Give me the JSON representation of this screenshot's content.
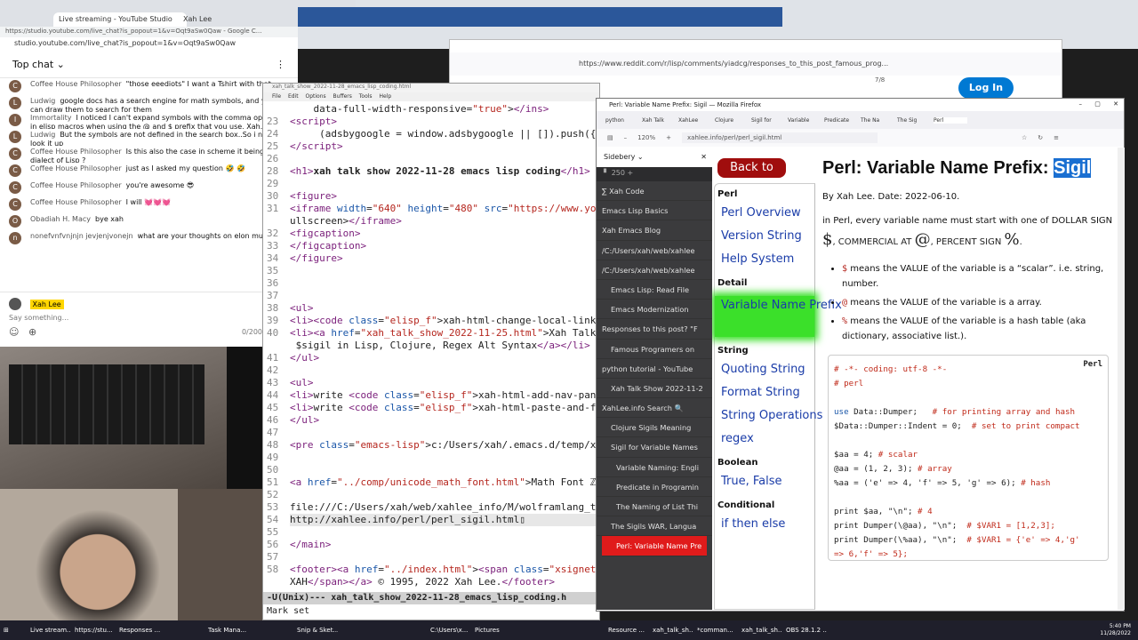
{
  "chrome_top": {
    "tab1": "Live streaming - YouTube Studio",
    "tab2": "Xah Lee",
    "url_full": "https://studio.youtube.com/live_chat?is_popout=1&v=Oqt9aSw0Qaw - Google C...",
    "url": "studio.youtube.com/live_chat?is_popout=1&v=Oqt9aSw0Qaw"
  },
  "chat": {
    "title": "Top chat",
    "messages": [
      {
        "author": "Coffee House Philosopher",
        "text": "\"those eeediots\" I want a Tshirt with that"
      },
      {
        "author": "Ludwig",
        "text": "google docs has a search engine for math symbols, and you can draw them to search for them"
      },
      {
        "author": "Immortality",
        "text": "I noticed I can't expand symbols with the comma operator in elisp macros when using the @ and $ prefix that you use, Xah. I'm not sure why."
      },
      {
        "author": "Ludwig",
        "text": "But the symbols are not defined in the search box..So i need look it up"
      },
      {
        "author": "Coffee House Philosopher",
        "text": "Is this also the case in scheme it being a dialect of Lisp ?"
      },
      {
        "author": "Coffee House Philosopher",
        "text": "just as I asked my question 🤣 🤣"
      },
      {
        "author": "Coffee House Philosopher",
        "text": "you're awesome 😎"
      },
      {
        "author": "Coffee House Philosopher",
        "text": "I will 💓💓💓"
      },
      {
        "author": "Obadiah H. Macy",
        "text": "bye xah"
      },
      {
        "author": "nonefvnfvnjnjn jevjenjvonejn",
        "text": "what are your thoughts on elon musk?"
      }
    ],
    "user": "Xah Lee",
    "placeholder": "Say something...",
    "count": "0/200"
  },
  "emacs": {
    "title": "xah_talk_show_2022-11-28_emacs_lisp_coding.html",
    "menu": "File Edit Options Buffers Tools Help",
    "modeline": "-U(Unix)---  xah_talk_show_2022-11-28_emacs_lisp_coding.h",
    "minibuffer": "Mark set"
  },
  "reddit": {
    "url": "https://www.reddit.com/r/lisp/comments/yiadcg/responses_to_this_post_famous_prog...",
    "login": "Log In",
    "page": "7/8"
  },
  "firefox": {
    "title": "Perl: Variable Name Prefix: Sigil — Mozilla Firefox",
    "zoom": "120%",
    "url": "xahlee.info/perl/perl_sigil.html",
    "tabs": [
      "python",
      "Xah Talk",
      "XahLee",
      "Clojure",
      "Sigil for",
      "Variable",
      "Predicate",
      "The Na",
      "The Sig",
      "Perl"
    ]
  },
  "sidebery": {
    "title": "Sidebery",
    "count": "250",
    "items": [
      {
        "label": "∑ Xah Code",
        "level": 0
      },
      {
        "label": "Emacs Lisp Basics",
        "level": 0
      },
      {
        "label": "Xah Emacs Blog",
        "level": 0
      },
      {
        "label": "/C:/Users/xah/web/xahlee",
        "level": 0
      },
      {
        "label": "/C:/Users/xah/web/xahlee",
        "level": 0
      },
      {
        "label": "Emacs Lisp: Read File",
        "level": 1
      },
      {
        "label": "Emacs Modernization",
        "level": 1
      },
      {
        "label": "Responses to this post? \"F",
        "level": 0
      },
      {
        "label": "Famous Programers on",
        "level": 1
      },
      {
        "label": "python tutorial - YouTube",
        "level": 0
      },
      {
        "label": "Xah Talk Show 2022-11-2",
        "level": 1
      },
      {
        "label": "XahLee.info Search 🔍",
        "level": 0
      },
      {
        "label": "Clojure Sigils Meaning",
        "level": 1
      },
      {
        "label": "Sigil for Variable Names",
        "level": 1
      },
      {
        "label": "Variable Naming: Engli",
        "level": 2
      },
      {
        "label": "Predicate in Programin",
        "level": 2
      },
      {
        "label": "The Naming of List Thi",
        "level": 2
      },
      {
        "label": "The Sigils WAR, Langua",
        "level": 1
      },
      {
        "label": "Perl: Variable Name Pre",
        "level": 1,
        "active": true
      }
    ]
  },
  "page": {
    "back": "Back to Perl",
    "nav": [
      {
        "h": "Perl"
      },
      {
        "l": "Perl Overview"
      },
      {
        "l": "Version String"
      },
      {
        "l": "Help System"
      },
      {
        "h": "Detail"
      },
      {
        "l": "Variable Name Prefix",
        "current": true
      },
      {
        "h": "String"
      },
      {
        "l": "Quoting String"
      },
      {
        "l": "Format String"
      },
      {
        "l": "String Operations"
      },
      {
        "l": "regex"
      },
      {
        "h": "Boolean"
      },
      {
        "l": "True, False"
      },
      {
        "h": "Conditional"
      },
      {
        "l": "if then else"
      }
    ],
    "h1": "Perl: Variable Name Prefix:",
    "h1_sel": "Sigil",
    "byline": "By Xah Lee. Date: 2022-06-10.",
    "intro": "in Perl, every variable name must start with one of DOLLAR SIGN",
    "dollar": "$",
    "commercial": ", COMMERCIAL AT ",
    "at": "@",
    "percent_label": ", PERCENT SIGN ",
    "percent": "%",
    "dot": ".",
    "bullets": [
      {
        "c": "$",
        "t": " means the VALUE of the variable is a “scalar”. i.e. string, number."
      },
      {
        "c": "@",
        "t": " means the VALUE of the variable is a array."
      },
      {
        "c": "%",
        "t": " means the VALUE of the variable is a hash table (aka dictionary, associative list.)."
      }
    ],
    "code_lang": "Perl"
  },
  "taskbar": {
    "items": [
      "Live stream...",
      "https://stu...",
      "Responses ...",
      "",
      "Task Mana...",
      "",
      "Snip & Sket...",
      "",
      "",
      "C:\\Users\\x...",
      "Pictures",
      "",
      "",
      "Resource ...",
      "xah_talk_sh...",
      "*comman...",
      "xah_talk_sh...",
      "OBS 28.1.2 ..."
    ],
    "time": "5:40 PM",
    "date": "11/28/2022",
    "lang": "ENG US"
  }
}
